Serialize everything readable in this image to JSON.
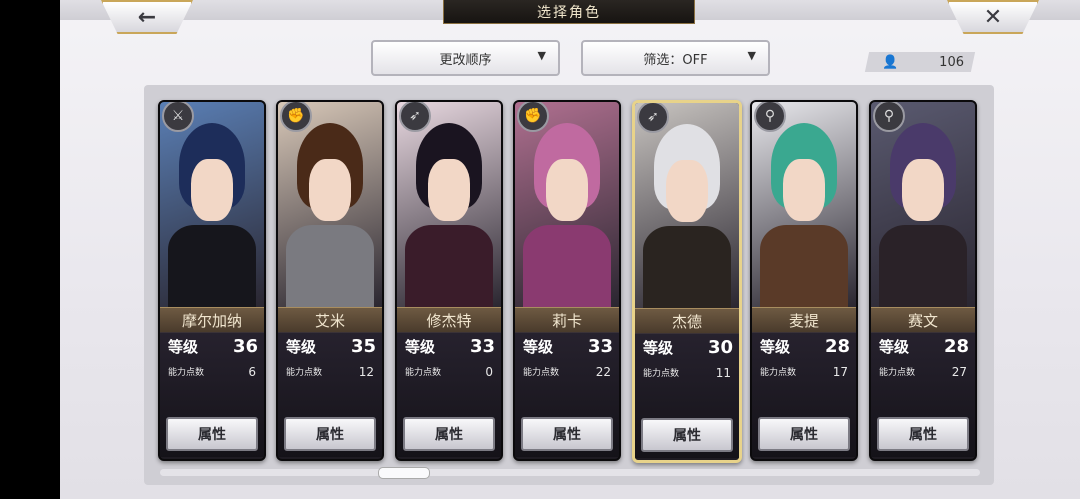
{
  "header": {
    "title": "选择角色",
    "back_icon": "←",
    "close_icon": "✕"
  },
  "controls": {
    "sort_label": "更改顺序",
    "filter_label": "筛选：OFF",
    "dropdown_arrow": "▼",
    "user_icon": "👤",
    "user_count": "106"
  },
  "characters": [
    {
      "name": "摩尔加纳",
      "level_label": "等级",
      "level": "36",
      "points_label": "能力点数",
      "points": "6",
      "button": "属性",
      "weapon_icon": "⚔",
      "hair": "#1d2d5a",
      "body": "#16161c",
      "bg": "#5a7fb5"
    },
    {
      "name": "艾米",
      "level_label": "等级",
      "level": "35",
      "points_label": "能力点数",
      "points": "12",
      "button": "属性",
      "weapon_icon": "✊",
      "hair": "#4a2a18",
      "body": "#7a7a80",
      "bg": "#d8c8b8"
    },
    {
      "name": "修杰特",
      "level_label": "等级",
      "level": "33",
      "points_label": "能力点数",
      "points": "0",
      "button": "属性",
      "weapon_icon": "➶",
      "hair": "#1a1420",
      "body": "#3a1c2a",
      "bg": "#e8d8e0"
    },
    {
      "name": "莉卡",
      "level_label": "等级",
      "level": "33",
      "points_label": "能力点数",
      "points": "22",
      "button": "属性",
      "weapon_icon": "✊",
      "hair": "#c06aa0",
      "body": "#8a3a70",
      "bg": "#b07090"
    },
    {
      "name": "杰德",
      "level_label": "等级",
      "level": "30",
      "points_label": "能力点数",
      "points": "11",
      "button": "属性",
      "weapon_icon": "➶",
      "hair": "#e0e0e4",
      "body": "#2a2420",
      "bg": "#c8c4c0"
    },
    {
      "name": "麦提",
      "level_label": "等级",
      "level": "28",
      "points_label": "能力点数",
      "points": "17",
      "button": "属性",
      "weapon_icon": "⚲",
      "hair": "#3aa890",
      "body": "#5a3a28",
      "bg": "#e8e8ec"
    },
    {
      "name": "赛文",
      "level_label": "等级",
      "level": "28",
      "points_label": "能力点数",
      "points": "27",
      "button": "属性",
      "weapon_icon": "⚲",
      "hair": "#4a3a6a",
      "body": "#2a2228",
      "bg": "#5a5a70"
    }
  ]
}
